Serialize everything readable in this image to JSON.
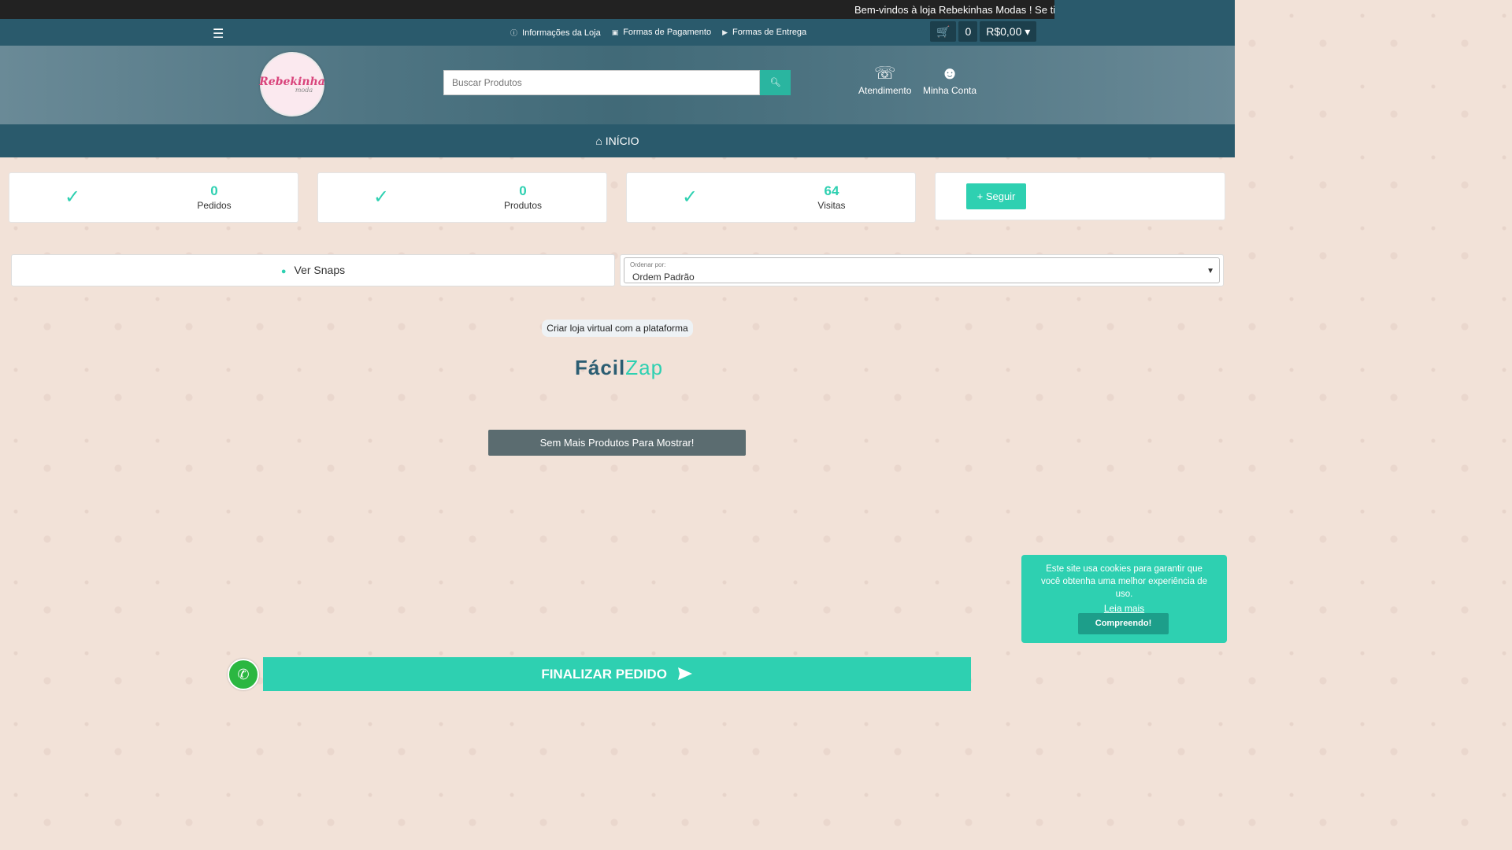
{
  "topbar": {
    "marquee": "Bem-vindos à loja Rebekinhas Modas ! Se tiver dú"
  },
  "navbar": {
    "links": [
      {
        "icon": "info-icon",
        "label": "Informações da Loja"
      },
      {
        "icon": "payment-icon",
        "label": "Formas de Pagamento"
      },
      {
        "icon": "truck-icon",
        "label": "Formas de Entrega"
      }
    ],
    "cart": {
      "count": "0",
      "total": "R$0,00"
    }
  },
  "header": {
    "logo_text": "Rebekinha",
    "logo_sub": "moda",
    "search_placeholder": "Buscar Produtos",
    "atendimento": "Atendimento",
    "minha_conta": "Minha Conta"
  },
  "menu": {
    "inicio": "INÍCIO"
  },
  "stats": [
    {
      "value": "0",
      "label": "Pedidos"
    },
    {
      "value": "0",
      "label": "Produtos"
    },
    {
      "value": "64",
      "label": "Visitas"
    }
  ],
  "follow_label": "Seguir",
  "snaps_label": "Ver Snaps",
  "sort": {
    "label": "Ordenar por:",
    "value": "Ordem Padrão"
  },
  "platform_label": "Criar loja virtual com a plataforma",
  "brand": {
    "part1": "Fácil",
    "part2": "Zap"
  },
  "no_more": "Sem Mais Produtos Para Mostrar!",
  "cookie": {
    "message": "Este site usa cookies para garantir que você obtenha uma melhor experiência de uso.",
    "more": "Leia mais",
    "ok": "Compreendo!"
  },
  "finalize_label": "FINALIZAR PEDIDO",
  "colors": {
    "teal": "#2ed0b1",
    "navy": "#2a5a6c",
    "dark": "#222222"
  }
}
